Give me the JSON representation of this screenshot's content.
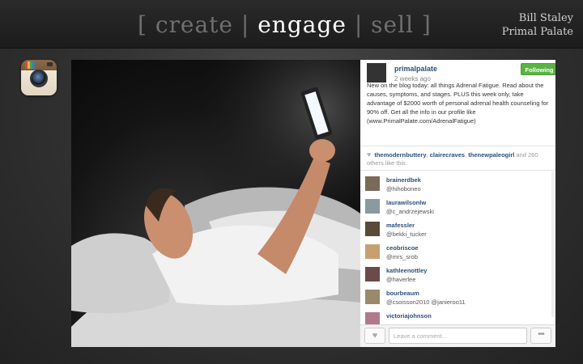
{
  "header": {
    "tagline_open": "[ ",
    "tagline_create": "create",
    "tagline_sep1": " | ",
    "tagline_engage": "engage",
    "tagline_sep2": " | ",
    "tagline_sell": "sell",
    "tagline_close": " ]",
    "author_name": "Bill Staley",
    "author_company": "Primal Palate"
  },
  "colors": {
    "accent_active": "#ffffff",
    "tagline_inactive": "#6f6f6f",
    "following_green": "#5ab442",
    "username_blue": "#2a4f7a"
  },
  "icons": {
    "app_logo": "instagram-icon",
    "heart": "heart-icon",
    "more": "more-options-icon"
  },
  "post": {
    "username": "primalpalate",
    "time": "2 weeks ago",
    "follow_label": "Following",
    "caption": "New on the blog today: all things Adrenal Fatigue. Read about the causes, symptoms, and stages. PLUS this week only, take advantage of $2000 worth of personal adrenal health counseling for 90% off. Get all the info in our profile like (www.PrimalPalate.com/AdrenalFatigue)"
  },
  "likes": {
    "users": [
      "themodernbuttery",
      "clairecraves",
      "thenewpaleogirl"
    ],
    "sep": ", ",
    "and_text": " and 260 others like this."
  },
  "comments": [
    {
      "user": "brainerdbek",
      "text": "@hihoboneo"
    },
    {
      "user": "laurawilsonlw",
      "text": "@c_andrzejewski"
    },
    {
      "user": "mafessler",
      "text": "@bekki_tucker"
    },
    {
      "user": "ceobriscoe",
      "text": "@mrs_srob"
    },
    {
      "user": "kathleenottley",
      "text": "@haverlee"
    },
    {
      "user": "bourbeaum",
      "text": "@csoisson2010 @janieroo11"
    },
    {
      "user": "victoriajohnson",
      "text": ""
    }
  ],
  "footer": {
    "comment_placeholder": "Leave a comment...",
    "more_label": "•••"
  }
}
